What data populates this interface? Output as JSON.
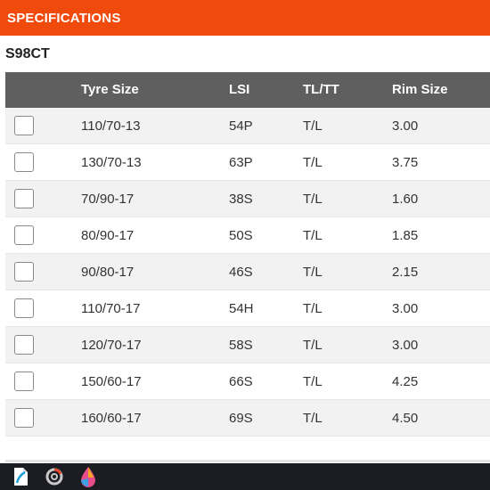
{
  "header": {
    "title": "SPECIFICATIONS"
  },
  "product": {
    "name": "S98CT"
  },
  "table": {
    "columns": [
      "Tyre Size",
      "LSI",
      "TL/TT",
      "Rim Size"
    ],
    "rows": [
      [
        "110/70-13",
        "54P",
        "T/L",
        "3.00"
      ],
      [
        "130/70-13",
        "63P",
        "T/L",
        "3.75"
      ],
      [
        "70/90-17",
        "38S",
        "T/L",
        "1.60"
      ],
      [
        "80/90-17",
        "50S",
        "T/L",
        "1.85"
      ],
      [
        "90/80-17",
        "46S",
        "T/L",
        "2.15"
      ],
      [
        "110/70-17",
        "54H",
        "T/L",
        "3.00"
      ],
      [
        "120/70-17",
        "58S",
        "T/L",
        "3.00"
      ],
      [
        "150/60-17",
        "66S",
        "T/L",
        "4.25"
      ],
      [
        "160/60-17",
        "69S",
        "T/L",
        "4.50"
      ]
    ]
  },
  "colors": {
    "accent": "#f04a0c",
    "header_bg": "#5f5f5f"
  },
  "taskbar": {
    "icons": [
      "document-app-icon",
      "settings-wheel-icon",
      "paint-drop-icon"
    ]
  }
}
